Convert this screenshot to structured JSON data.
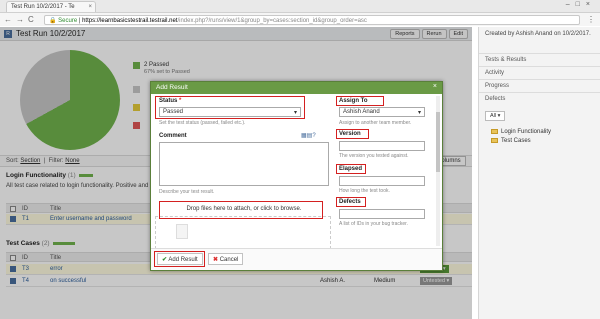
{
  "browser": {
    "tab_title": "Test Run 10/2/2017 - Te",
    "secure_label": "Secure",
    "url_domain": "https://learnbasicstestrail.testrail.net",
    "url_path": "/index.php?/runs/view/1&group_by=cases:section_id&group_order=asc"
  },
  "page": {
    "run_title": "Test Run 10/2/2017",
    "toolbar": [
      "Reports",
      "Rerun",
      "Edit"
    ]
  },
  "sidebar": {
    "created_by": "Created by Ashish Anand on 10/2/2017.",
    "items": [
      "Tests & Results",
      "Activity",
      "Progress",
      "Defects"
    ],
    "filter_all": "All",
    "folders": [
      "Login Functionality",
      "Test Cases"
    ]
  },
  "summary": {
    "passed_label": "2 Passed",
    "passed_sub": "67% set to Passed",
    "colors": {
      "passed": "#71b44e",
      "blocked": "#c8c8c8",
      "retest": "#e6cc3a",
      "failed": "#e05656"
    }
  },
  "filterbar": {
    "sort_label": "Sort:",
    "sort_value": "Section",
    "filter_label": "Filter:",
    "filter_value": "None",
    "columns_btn": "Columns"
  },
  "section1": {
    "title": "Login Functionality",
    "count": "(1)",
    "description": "All test case related to login functionality. Positive and",
    "header_id": "ID",
    "header_title": "Title",
    "rows": [
      {
        "id": "T1",
        "title": "Enter username and password"
      }
    ]
  },
  "section2": {
    "title": "Test Cases",
    "count": "(2)",
    "header_id": "ID",
    "header_title": "Title",
    "rows": [
      {
        "id": "T3",
        "title": "error",
        "assignee": "Ashish A.",
        "priority": "Medium",
        "status": "Passed"
      },
      {
        "id": "T4",
        "title": "on successful",
        "assignee": "Ashish A.",
        "priority": "Medium",
        "status": "Untested"
      }
    ]
  },
  "dialog": {
    "title": "Add Result",
    "status_label": "Status",
    "status_value": "Passed",
    "status_help": "Set the test status (passed, failed etc.).",
    "comment_label": "Comment",
    "comment_help": "Describe your test result.",
    "drop_text": "Drop files here to attach, or click to browse.",
    "assign_label": "Assign To",
    "assign_value": "Ashish Anand",
    "assign_help": "Assign to another team member.",
    "version_label": "Version",
    "version_help": "The version you tested against.",
    "elapsed_label": "Elapsed",
    "elapsed_help": "How long the test took.",
    "defects_label": "Defects",
    "defects_help": "A list of IDs in your bug tracker.",
    "add_button": "Add Result",
    "cancel_button": "Cancel"
  }
}
